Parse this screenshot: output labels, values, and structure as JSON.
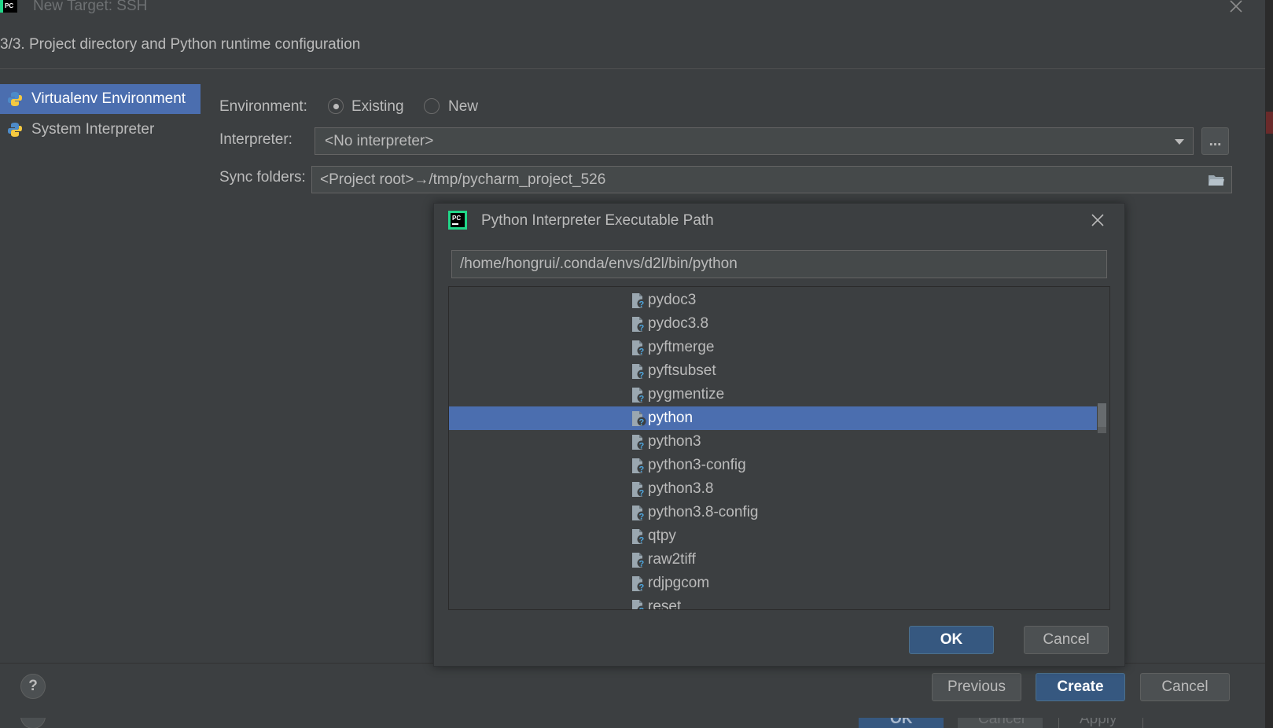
{
  "window": {
    "title": "New Target: SSH",
    "step_label": "3/3. Project directory and Python runtime configuration"
  },
  "sidebar": {
    "items": [
      {
        "label": "Virtualenv Environment",
        "selected": true
      },
      {
        "label": "System Interpreter",
        "selected": false
      }
    ]
  },
  "form": {
    "environment_label": "Environment:",
    "environment_options": [
      {
        "label": "Existing",
        "checked": true
      },
      {
        "label": "New",
        "checked": false
      }
    ],
    "interpreter_label": "Interpreter:",
    "interpreter_value": "<No interpreter>",
    "interpreter_browse_label": "...",
    "sync_label": "Sync folders:",
    "sync_value": "<Project root>→/tmp/pycharm_project_526"
  },
  "footer": {
    "help_label": "?",
    "previous_label": "Previous",
    "create_label": "Create",
    "cancel_label": "Cancel"
  },
  "underlying": {
    "ok_label": "OK",
    "cancel_label": "Cancel",
    "apply_label": "Apply"
  },
  "modal": {
    "title": "Python Interpreter Executable Path",
    "path_value": "/home/hongrui/.conda/envs/d2l/bin/python",
    "files": [
      {
        "name": "pydoc3",
        "selected": false
      },
      {
        "name": "pydoc3.8",
        "selected": false
      },
      {
        "name": "pyftmerge",
        "selected": false
      },
      {
        "name": "pyftsubset",
        "selected": false
      },
      {
        "name": "pygmentize",
        "selected": false
      },
      {
        "name": "python",
        "selected": true
      },
      {
        "name": "python3",
        "selected": false
      },
      {
        "name": "python3-config",
        "selected": false
      },
      {
        "name": "python3.8",
        "selected": false
      },
      {
        "name": "python3.8-config",
        "selected": false
      },
      {
        "name": "qtpy",
        "selected": false
      },
      {
        "name": "raw2tiff",
        "selected": false
      },
      {
        "name": "rdjpgcom",
        "selected": false
      },
      {
        "name": "reset",
        "selected": false
      }
    ],
    "ok_label": "OK",
    "cancel_label": "Cancel"
  },
  "colors": {
    "background": "#3c3f41",
    "selection": "#4b6eaf",
    "primary_button": "#365880",
    "text": "#bbbbbb"
  },
  "icons": {
    "app_logo": "pycharm-logo-icon",
    "python": "python-icon",
    "file": "unknown-file-icon",
    "folder": "folder-icon"
  }
}
